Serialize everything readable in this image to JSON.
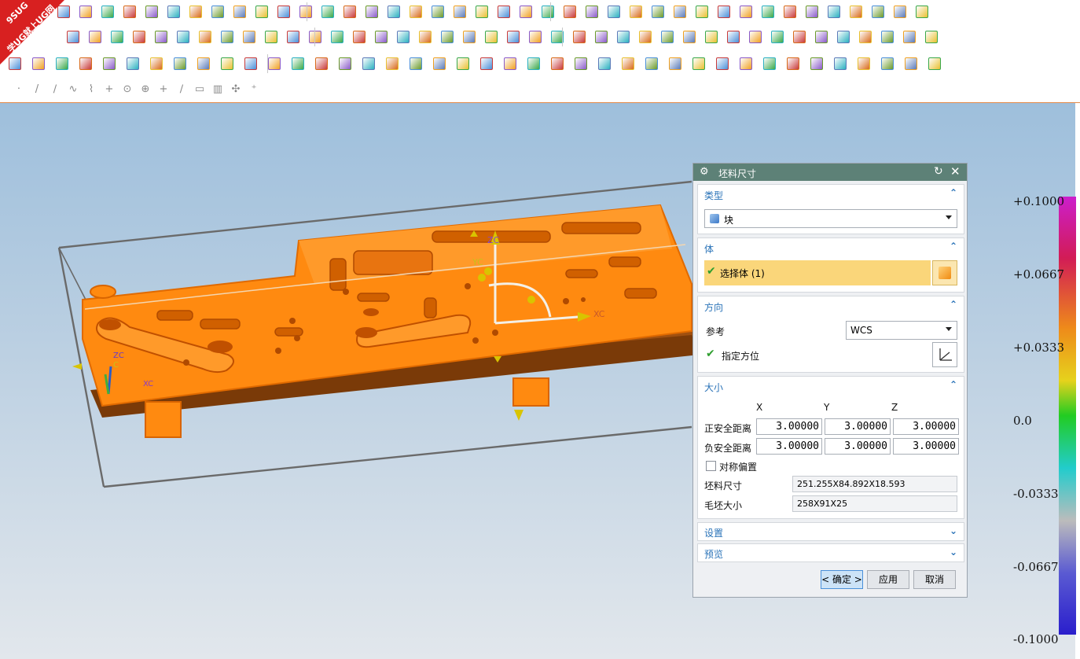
{
  "logo": {
    "line1": "9SUG",
    "line2": "学UG就上UG网"
  },
  "dialog": {
    "title": "坯料尺寸",
    "type_section": {
      "header": "类型",
      "value": "块"
    },
    "body_section": {
      "header": "体",
      "select_label": "选择体 (1)"
    },
    "direction_section": {
      "header": "方向",
      "reference_label": "参考",
      "reference_value": "WCS",
      "orient_label": "指定方位"
    },
    "size_section": {
      "header": "大小",
      "columns": [
        "X",
        "Y",
        "Z"
      ],
      "pos_label": "正安全距离",
      "neg_label": "负安全距离",
      "pos_values": [
        "3.00000",
        "3.00000",
        "3.00000"
      ],
      "neg_values": [
        "3.00000",
        "3.00000",
        "3.00000"
      ],
      "symmetric_label": "对称偏置",
      "stock_size_label": "坯料尺寸",
      "stock_size_value": "251.255X84.892X18.593",
      "blank_size_label": "毛坯大小",
      "blank_size_value": "258X91X25"
    },
    "settings_header": "设置",
    "preview_header": "预览",
    "buttons": {
      "ok": "< 确定 >",
      "apply": "应用",
      "cancel": "取消"
    }
  },
  "viewport": {
    "axis_labels": {
      "zc_main": "ZC",
      "yc_main": "YC",
      "xc_main": "XC",
      "zc_small": "ZC",
      "c_small": "C",
      "xc_small": "XC"
    }
  },
  "color_scale": {
    "labels": [
      "+0.1000",
      "+0.0667",
      "+0.0333",
      "0.0",
      "-0.0333",
      "-0.0667",
      "-0.1000"
    ]
  },
  "colors": {
    "model": "#ff8a10",
    "title_bar": "#5d8177",
    "section_header": "#2a73b8",
    "selection": "#fad67a"
  }
}
